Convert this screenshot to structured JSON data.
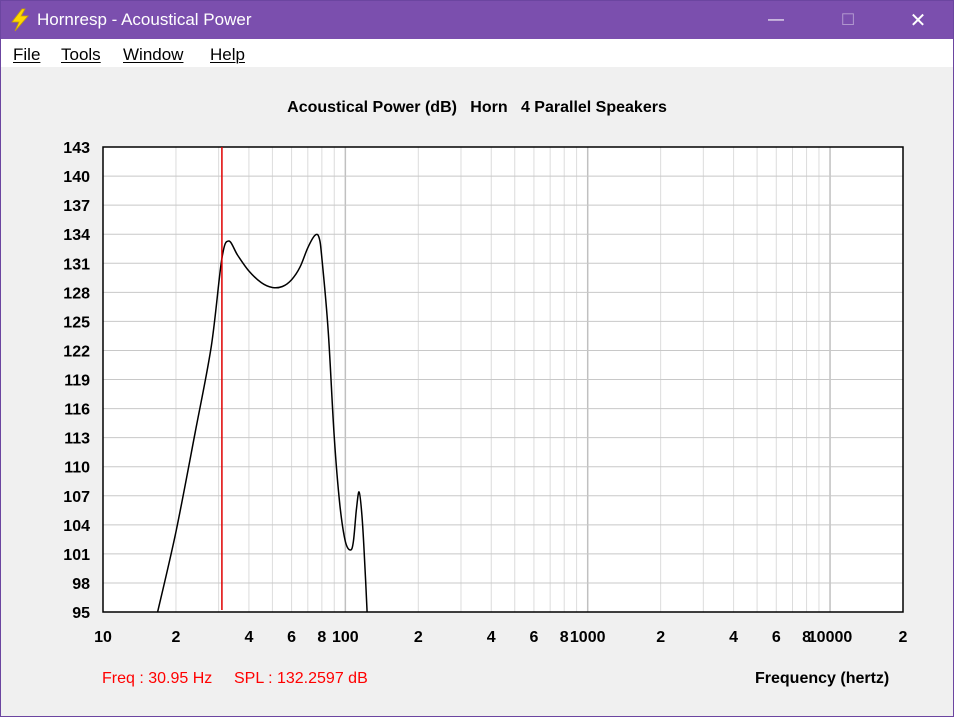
{
  "window": {
    "title": "Hornresp - Acoustical Power",
    "minimize_glyph": "—",
    "maximize_glyph": "☐",
    "close_glyph": "✕",
    "icon": "lightning-bolt-icon"
  },
  "menu": {
    "items": [
      {
        "label": "File"
      },
      {
        "label": "Tools"
      },
      {
        "label": "Window"
      },
      {
        "label": "Help"
      }
    ]
  },
  "readout": {
    "freq": "Freq : 30.95 Hz",
    "spl": "SPL : 132.2597 dB"
  },
  "colors": {
    "titlebar": "#7b4fae",
    "curve": "#000000",
    "marker": "#e00000",
    "grid": "#c8c8c8"
  },
  "chart_data": {
    "type": "line",
    "title": "Acoustical Power (dB)   Horn   4 Parallel Speakers",
    "xlabel": "Frequency (hertz)",
    "ylabel": "",
    "x_scale": "log",
    "xlim": [
      10,
      20000
    ],
    "ylim": [
      95,
      143
    ],
    "yticks": [
      95,
      98,
      101,
      104,
      107,
      110,
      113,
      116,
      119,
      122,
      125,
      128,
      131,
      134,
      137,
      140,
      143
    ],
    "xtick_labels": [
      {
        "value": 10,
        "label": "10"
      },
      {
        "value": 20,
        "label": "2"
      },
      {
        "value": 40,
        "label": "4"
      },
      {
        "value": 60,
        "label": "6"
      },
      {
        "value": 80,
        "label": "8"
      },
      {
        "value": 100,
        "label": "100"
      },
      {
        "value": 200,
        "label": "2"
      },
      {
        "value": 400,
        "label": "4"
      },
      {
        "value": 600,
        "label": "6"
      },
      {
        "value": 800,
        "label": "8"
      },
      {
        "value": 1000,
        "label": "1000"
      },
      {
        "value": 2000,
        "label": "2"
      },
      {
        "value": 4000,
        "label": "4"
      },
      {
        "value": 6000,
        "label": "6"
      },
      {
        "value": 8000,
        "label": "8"
      },
      {
        "value": 10000,
        "label": "10000"
      },
      {
        "value": 20000,
        "label": "2"
      }
    ],
    "grid": true,
    "marker_x": 30.95,
    "series": [
      {
        "x": [
          16.8,
          20,
          24,
          28,
          30.95,
          33,
          36,
          40,
          45,
          50,
          55,
          60,
          65,
          70,
          75,
          78,
          80,
          85,
          90,
          95,
          100,
          105,
          108,
          111,
          114,
          117,
          120,
          123
        ],
        "y": [
          95,
          103.3,
          113.5,
          122.5,
          131.5,
          133.3,
          131.8,
          130.2,
          129.0,
          128.5,
          128.6,
          129.3,
          130.6,
          132.6,
          133.9,
          133.6,
          131.5,
          124.0,
          113.0,
          106.0,
          102.3,
          101.4,
          102.3,
          105.5,
          107.4,
          105.0,
          100.5,
          95
        ]
      }
    ]
  }
}
